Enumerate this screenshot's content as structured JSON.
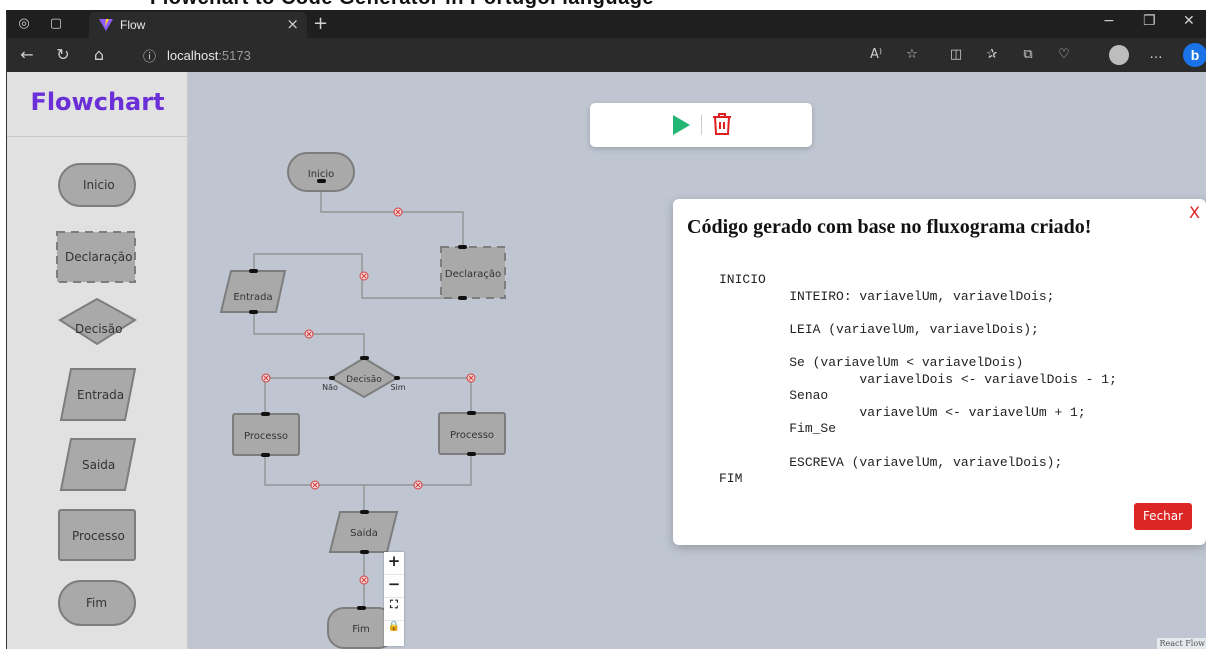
{
  "caption": "Flowchart to Code Generator in Portugol language",
  "browser": {
    "tab_title": "Flow",
    "url_host": "localhost",
    "url_port": ":5173",
    "read_aloud_label": "A⁾"
  },
  "sidebar": {
    "brand": "Flowchart",
    "items": [
      {
        "label": "Inicio"
      },
      {
        "label": "Declaração"
      },
      {
        "label": "Decisão"
      },
      {
        "label": "Entrada"
      },
      {
        "label": "Saida"
      },
      {
        "label": "Processo"
      },
      {
        "label": "Fim"
      }
    ]
  },
  "flow": {
    "nodes": {
      "inicio": "Inicio",
      "declaracao": "Declaração",
      "entrada": "Entrada",
      "decisao": "Decisão",
      "processo_left": "Processo",
      "processo_right": "Processo",
      "saida": "Saida",
      "fim": "Fim"
    },
    "branch_no": "Não",
    "branch_yes": "Sim"
  },
  "zoom_controls": {
    "zoom_in": "+",
    "zoom_out": "−",
    "fit_view": "⛶",
    "lock": "🔒"
  },
  "attribution": "React Flow",
  "modal": {
    "title": "Código gerado com base no fluxograma criado!",
    "close": "X",
    "code": "INICIO\n         INTEIRO: variavelUm, variavelDois;\n\n         LEIA (variavelUm, variavelDois);\n\n         Se (variavelUm < variavelDois)\n                  variavelDois <- variavelDois - 1;\n         Senao\n                  variavelUm <- variavelUm + 1;\n         Fim_Se\n\n         ESCREVA (variavelUm, variavelDois);\nFIM",
    "button": "Fechar"
  },
  "colors": {
    "brand": "#6a2fd6",
    "run": "#22b573",
    "trash": "#e02020",
    "danger_button": "#dc2626",
    "node_fill": "#a9a9a9",
    "node_border": "#7d7d7d",
    "edge_delete": "#d43c3c"
  }
}
